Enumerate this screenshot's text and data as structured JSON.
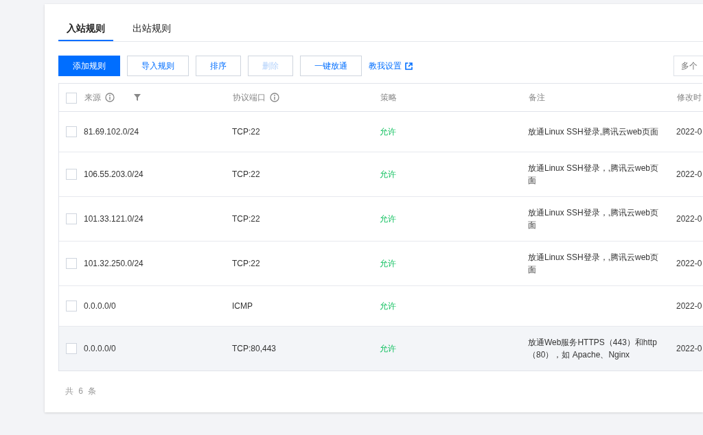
{
  "tabs": [
    {
      "label": "入站规则",
      "selected": true
    },
    {
      "label": "出站规则",
      "selected": false
    }
  ],
  "toolbar": {
    "buttons": [
      {
        "label": "添加规则",
        "kind": "primary",
        "disabled": false
      },
      {
        "label": "导入规则",
        "kind": "default",
        "disabled": false
      },
      {
        "label": "排序",
        "kind": "default",
        "disabled": false
      },
      {
        "label": "删除",
        "kind": "default",
        "disabled": true
      },
      {
        "label": "一键放通",
        "kind": "default",
        "disabled": false
      }
    ],
    "help_link": "教我设置",
    "search": {
      "placeholder": "多个"
    }
  },
  "table": {
    "select_all_checked": false,
    "columns": [
      "来源",
      "协议端口",
      "策略",
      "备注",
      "修改时"
    ],
    "rows": [
      {
        "source": "81.69.102.0/24",
        "port": "TCP:22",
        "policy": "允许",
        "note": "放通Linux SSH登录,腾讯云web页面",
        "time": "2022-0",
        "checked": false,
        "highlighted": false
      },
      {
        "source": "106.55.203.0/24",
        "port": "TCP:22",
        "policy": "允许",
        "note": "放通Linux SSH登录，,腾讯云web页面",
        "time": "2022-0",
        "checked": false,
        "highlighted": false
      },
      {
        "source": "101.33.121.0/24",
        "port": "TCP:22",
        "policy": "允许",
        "note": "放通Linux SSH登录，,腾讯云web页面",
        "time": "2022-0",
        "checked": false,
        "highlighted": false
      },
      {
        "source": "101.32.250.0/24",
        "port": "TCP:22",
        "policy": "允许",
        "note": "放通Linux SSH登录，,腾讯云web页面",
        "time": "2022-0",
        "checked": false,
        "highlighted": false
      },
      {
        "source": "0.0.0.0/0",
        "port": "ICMP",
        "policy": "允许",
        "time": "2022-0",
        "checked": false,
        "highlighted": false
      },
      {
        "source": "0.0.0.0/0",
        "port": "TCP:80,443",
        "policy": "允许",
        "note": "放通Web服务HTTPS（443）和http（80），如 Apache、Nginx",
        "time": "2022-0",
        "checked": false,
        "highlighted": true
      }
    ]
  },
  "footer": {
    "total": "共 6 条"
  }
}
